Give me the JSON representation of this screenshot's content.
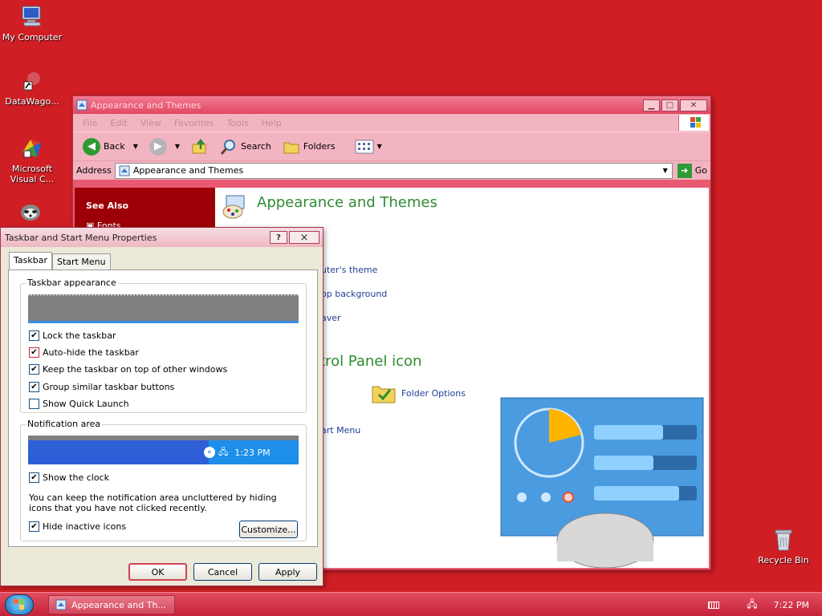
{
  "desktop": {
    "icons": [
      {
        "label": "My Computer",
        "icon": "computer-icon"
      },
      {
        "label": "DataWago...",
        "icon": "shortcut-icon"
      },
      {
        "label": "Microsoft Visual C...",
        "icon": "visual-c-icon"
      },
      {
        "label": "Recycle Bin",
        "icon": "recycle-bin-icon"
      }
    ]
  },
  "explorer": {
    "title": "Appearance and Themes",
    "menu": [
      "File",
      "Edit",
      "View",
      "Favorites",
      "Tools",
      "Help"
    ],
    "toolbar": {
      "back": "Back",
      "search": "Search",
      "folders": "Folders"
    },
    "address_label": "Address",
    "address_value": "Appearance and Themes",
    "go": "Go",
    "see_also": "See Also",
    "fonts": "Fonts",
    "heading": "Appearance and Themes",
    "links": {
      "theme": "uter's theme",
      "background": "op background",
      "saver": "aver",
      "folder_options": "Folder Options",
      "start_menu": "art Menu"
    },
    "panel_heading": "trol Panel icon"
  },
  "dialog": {
    "title": "Taskbar and Start Menu Properties",
    "help": "?",
    "close": "×",
    "tabs": [
      "Taskbar",
      "Start Menu"
    ],
    "appearance_label": "Taskbar appearance",
    "checks": [
      {
        "label": "Lock the taskbar",
        "checked": true
      },
      {
        "label": "Auto-hide the taskbar",
        "checked": true
      },
      {
        "label": "Keep the taskbar on top of other windows",
        "checked": true
      },
      {
        "label": "Group similar taskbar buttons",
        "checked": true
      },
      {
        "label": "Show Quick Launch",
        "checked": false
      }
    ],
    "notification_label": "Notification area",
    "preview_time": "1:23 PM",
    "show_clock": "Show the clock",
    "info": "You can keep the notification area uncluttered by hiding icons that you have not clicked recently.",
    "hide_inactive": "Hide inactive icons",
    "customize": "Customize...",
    "ok": "OK",
    "cancel": "Cancel",
    "apply": "Apply"
  },
  "taskbar": {
    "task_label": "Appearance and Th...",
    "time": "7:22 PM"
  }
}
